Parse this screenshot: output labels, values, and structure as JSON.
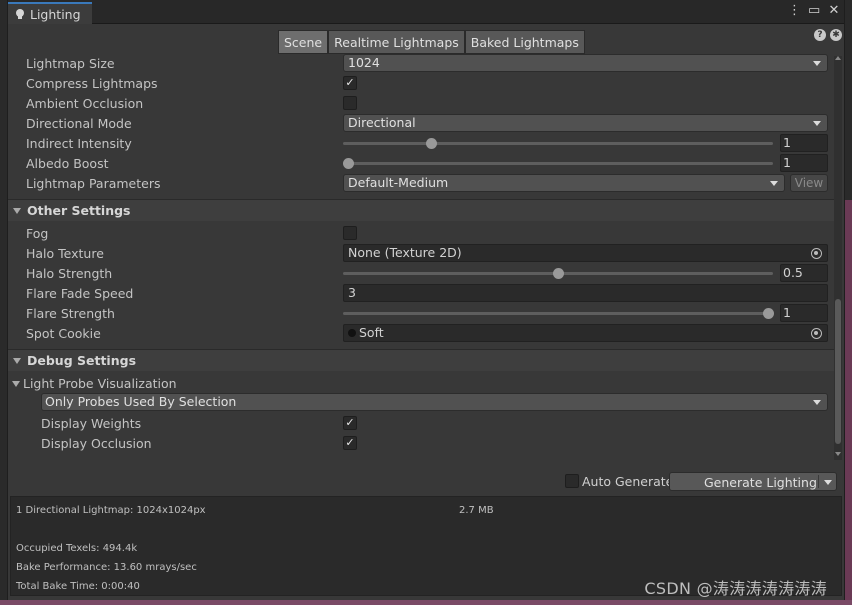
{
  "window": {
    "tab_title": "Lighting",
    "icons": [
      "more-vert-icon",
      "maximize-icon",
      "close-icon"
    ]
  },
  "toolbar": {
    "tabs": [
      {
        "label": "Scene",
        "active": true
      },
      {
        "label": "Realtime Lightmaps",
        "active": false
      },
      {
        "label": "Baked Lightmaps",
        "active": false
      }
    ],
    "icons": [
      "help-icon",
      "settings-icon"
    ]
  },
  "lightmap": {
    "size_label": "Lightmap Size",
    "size_value": "1024",
    "compress_label": "Compress Lightmaps",
    "compress_checked": true,
    "ao_label": "Ambient Occlusion",
    "ao_checked": false,
    "directional_label": "Directional Mode",
    "directional_value": "Directional",
    "indirect_label": "Indirect Intensity",
    "indirect_value": "1",
    "indirect_level": 0.2,
    "albedo_label": "Albedo Boost",
    "albedo_value": "1",
    "albedo_level": 0.0,
    "params_label": "Lightmap Parameters",
    "params_value": "Default-Medium",
    "view_label": "View"
  },
  "other": {
    "title": "Other Settings",
    "fog_label": "Fog",
    "fog_checked": false,
    "halo_texture_label": "Halo Texture",
    "halo_texture_value": "None (Texture 2D)",
    "halo_strength_label": "Halo Strength",
    "halo_strength_value": "0.5",
    "halo_strength_level": 0.5,
    "flare_fade_label": "Flare Fade Speed",
    "flare_fade_value": "3",
    "flare_strength_label": "Flare Strength",
    "flare_strength_value": "1",
    "flare_strength_level": 1.0,
    "spot_cookie_label": "Spot Cookie",
    "spot_cookie_value": "Soft"
  },
  "debug": {
    "title": "Debug Settings",
    "probe_vis_label": "Light Probe Visualization",
    "probe_mode_value": "Only Probes Used By Selection",
    "weights_label": "Display Weights",
    "weights_checked": true,
    "occlusion_label": "Display Occlusion",
    "occlusion_checked": true
  },
  "generate": {
    "auto_label": "Auto Generate",
    "auto_checked": false,
    "button_label": "Generate Lighting"
  },
  "stats": {
    "lightmap_line": "1 Directional Lightmap: 1024x1024px",
    "lightmap_size": "2.7 MB",
    "texels": "Occupied Texels: 494.4k",
    "performance": "Bake Performance: 13.60 mrays/sec",
    "bake_time": "Total Bake Time: 0:00:40"
  },
  "watermark": "CSDN @涛涛涛涛涛涛涛",
  "colors": {
    "panel": "#383838",
    "field": "#2a2a2a",
    "accent": "#3a79bb"
  }
}
